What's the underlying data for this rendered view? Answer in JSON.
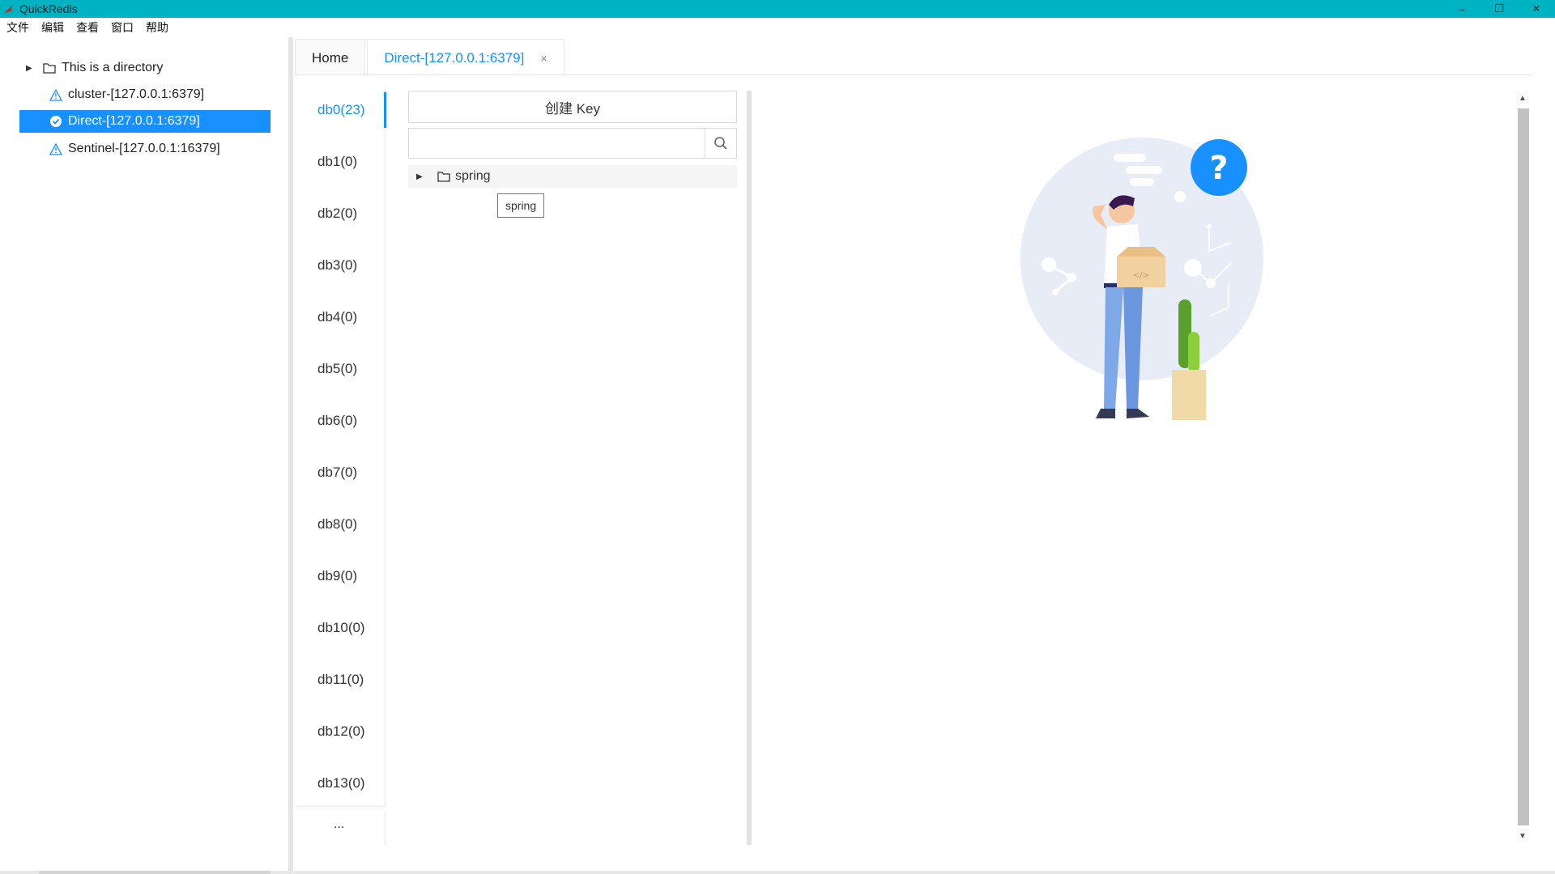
{
  "titlebar": {
    "title": "QuickRedis",
    "minimize": "–",
    "restore": "❐",
    "close": "✕"
  },
  "menu": [
    "文件",
    "编辑",
    "查看",
    "窗口",
    "帮助"
  ],
  "connections": [
    {
      "label": "This is a directory",
      "icon": "folder-icon",
      "expandable": true
    },
    {
      "label": "cluster-[127.0.0.1:6379]",
      "icon": "warning-icon"
    },
    {
      "label": "Direct-[127.0.0.1:6379]",
      "icon": "check-circle-icon",
      "selected": true
    },
    {
      "label": "Sentinel-[127.0.0.1:16379]",
      "icon": "warning-icon"
    }
  ],
  "tabs": [
    {
      "label": "Home"
    },
    {
      "label": "Direct-[127.0.0.1:6379]",
      "active": true,
      "close": "×"
    }
  ],
  "databases": [
    "db0(23)",
    "db1(0)",
    "db2(0)",
    "db3(0)",
    "db4(0)",
    "db5(0)",
    "db6(0)",
    "db7(0)",
    "db8(0)",
    "db9(0)",
    "db10(0)",
    "db11(0)",
    "db12(0)",
    "db13(0)"
  ],
  "db_more": "...",
  "key_panel": {
    "create_button": "创建 Key",
    "search_value": "",
    "tree": [
      {
        "label": "spring"
      }
    ],
    "tooltip": "spring"
  },
  "colors": {
    "titlebar": "#00b3c2",
    "accent": "#1890ff"
  }
}
